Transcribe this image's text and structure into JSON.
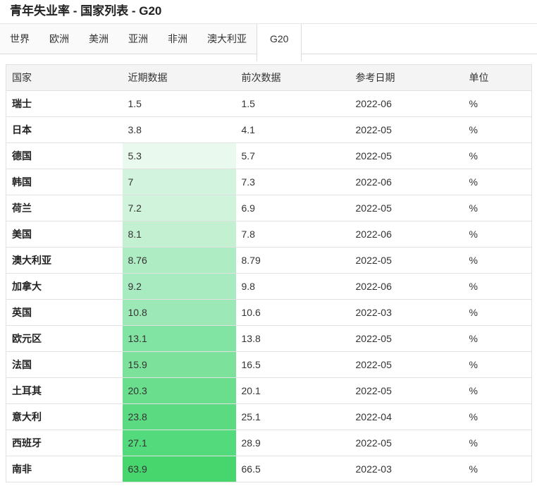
{
  "page": {
    "title": "青年失业率 - 国家列表 - G20"
  },
  "tabs": {
    "items": [
      {
        "id": "world",
        "label": "世界",
        "active": false
      },
      {
        "id": "europe",
        "label": "欧洲",
        "active": false
      },
      {
        "id": "america",
        "label": "美洲",
        "active": false
      },
      {
        "id": "asia",
        "label": "亚洲",
        "active": false
      },
      {
        "id": "africa",
        "label": "非洲",
        "active": false
      },
      {
        "id": "australia",
        "label": "澳大利亚",
        "active": false
      },
      {
        "id": "g20",
        "label": "G20",
        "active": true
      }
    ]
  },
  "table": {
    "columns": [
      "国家",
      "近期数据",
      "前次数据",
      "参考日期",
      "单位"
    ],
    "rows": [
      {
        "country": "瑞士",
        "last": "1.5",
        "previous": "1.5",
        "reference": "2022-06",
        "unit": "%",
        "color": ""
      },
      {
        "country": "日本",
        "last": "3.8",
        "previous": "4.1",
        "reference": "2022-05",
        "unit": "%",
        "color": ""
      },
      {
        "country": "德国",
        "last": "5.3",
        "previous": "5.7",
        "reference": "2022-05",
        "unit": "%",
        "color": "#e9f9ee"
      },
      {
        "country": "韩国",
        "last": "7",
        "previous": "7.3",
        "reference": "2022-06",
        "unit": "%",
        "color": "#d2f3dd"
      },
      {
        "country": "荷兰",
        "last": "7.2",
        "previous": "6.9",
        "reference": "2022-05",
        "unit": "%",
        "color": "#d0f3db"
      },
      {
        "country": "美国",
        "last": "8.1",
        "previous": "7.8",
        "reference": "2022-06",
        "unit": "%",
        "color": "#c2f0d1"
      },
      {
        "country": "澳大利亚",
        "last": "8.76",
        "previous": "8.79",
        "reference": "2022-05",
        "unit": "%",
        "color": "#aeecc3"
      },
      {
        "country": "加拿大",
        "last": "9.2",
        "previous": "9.8",
        "reference": "2022-06",
        "unit": "%",
        "color": "#a9ebc0"
      },
      {
        "country": "英国",
        "last": "10.8",
        "previous": "10.6",
        "reference": "2022-03",
        "unit": "%",
        "color": "#9de8b7"
      },
      {
        "country": "欧元区",
        "last": "13.1",
        "previous": "13.8",
        "reference": "2022-05",
        "unit": "%",
        "color": "#82e4a2"
      },
      {
        "country": "法国",
        "last": "15.9",
        "previous": "16.5",
        "reference": "2022-05",
        "unit": "%",
        "color": "#7ce29b"
      },
      {
        "country": "土耳其",
        "last": "20.3",
        "previous": "20.1",
        "reference": "2022-05",
        "unit": "%",
        "color": "#6ade8d"
      },
      {
        "country": "意大利",
        "last": "23.8",
        "previous": "25.1",
        "reference": "2022-04",
        "unit": "%",
        "color": "#5bda81"
      },
      {
        "country": "西班牙",
        "last": "27.1",
        "previous": "28.9",
        "reference": "2022-05",
        "unit": "%",
        "color": "#53da7c"
      },
      {
        "country": "南非",
        "last": "63.9",
        "previous": "66.5",
        "reference": "2022-03",
        "unit": "%",
        "color": "#47d66e"
      }
    ]
  },
  "colors": {
    "heat_low": "#ffffff",
    "heat_high": "#47d66e",
    "header_bg": "#f4f4f4",
    "border": "#e1e1e1",
    "tab_inactive_bg": "#fafafa"
  }
}
